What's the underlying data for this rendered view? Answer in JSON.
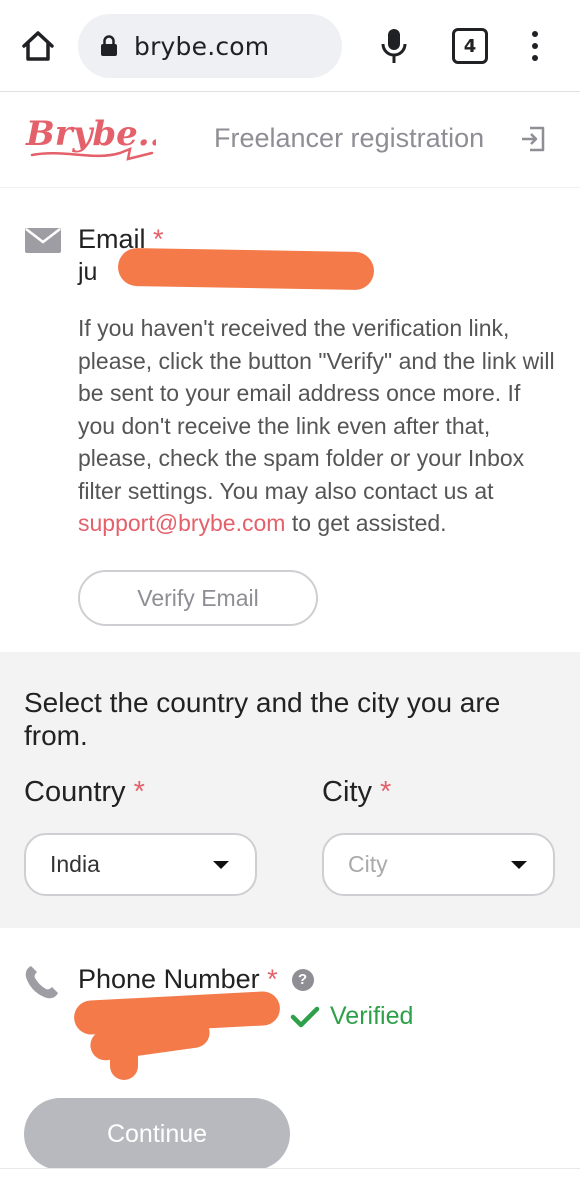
{
  "browser": {
    "url": "brybe.com",
    "tab_count": "4"
  },
  "header": {
    "logo_text": "Brybe...",
    "title": "Freelancer registration"
  },
  "email": {
    "label": "Email",
    "required_mark": "*",
    "value": "ju",
    "info_before_link": "If you haven't received the verification link, please, click the button \"Verify\" and the link will be sent to your email address once more. If you don't receive the link even after that, please, check the spam folder or your Inbox filter settings. You may also contact us at ",
    "info_link": "support@brybe.com",
    "info_after_link": " to get assisted.",
    "verify_button": "Verify Email"
  },
  "location": {
    "heading": "Select the country and the city you are from.",
    "country_label": "Country",
    "city_label": "City",
    "required_mark": "*",
    "country_value": "India",
    "city_placeholder": "City"
  },
  "phone": {
    "label": "Phone Number",
    "required_mark": "*",
    "help_glyph": "?",
    "value": "+",
    "status": "Verified"
  },
  "actions": {
    "continue_button": "Continue"
  },
  "colors": {
    "brand": "#e4606a",
    "verified": "#2ea04a",
    "redaction": "#f47a4a",
    "disabled_button": "#b8b9be"
  },
  "icons": [
    "home-icon",
    "lock-icon",
    "mic-icon",
    "tabs-icon",
    "more-vert-icon",
    "exit-icon",
    "mail-icon",
    "phone-icon",
    "help-icon",
    "check-icon",
    "caret-down-icon"
  ]
}
